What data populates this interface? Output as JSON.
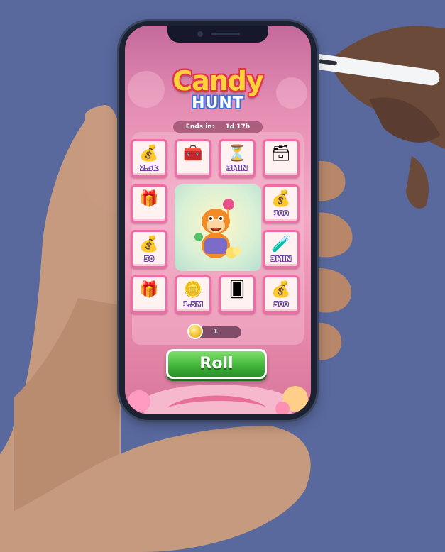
{
  "game": {
    "logo_line1": "Candy",
    "logo_line2": "HUNT",
    "ends_label": "Ends in:",
    "ends_value": "1d 17h"
  },
  "board": {
    "tiles": [
      {
        "icon": "coin-bag-icon",
        "label": "2.5K"
      },
      {
        "icon": "treasure-chest-pink-icon",
        "label": ""
      },
      {
        "icon": "hourglass-icon",
        "label": "3MIN"
      },
      {
        "icon": "blue-chest-icon",
        "label": ""
      },
      {
        "icon": "gold-chest-icon",
        "label": ""
      },
      {
        "icon": "coin-bag-icon",
        "label": "100"
      },
      {
        "icon": "coin-bag-icon",
        "label": "50"
      },
      {
        "icon": "potion-clock-icon",
        "label": "3MIN"
      },
      {
        "icon": "gift-box-icon",
        "label": ""
      },
      {
        "icon": "gold-coins-icon",
        "label": "1.5M"
      },
      {
        "icon": "blue-card-icon",
        "label": ""
      },
      {
        "icon": "coin-bag-icon",
        "label": "500"
      }
    ],
    "center": "orange-monkey-mascot"
  },
  "dice_counter": "1",
  "roll_button": "Roll",
  "colors": {
    "background": "#59699e",
    "tile_border": "#f36aa7",
    "roll_green": "#3fb338"
  }
}
